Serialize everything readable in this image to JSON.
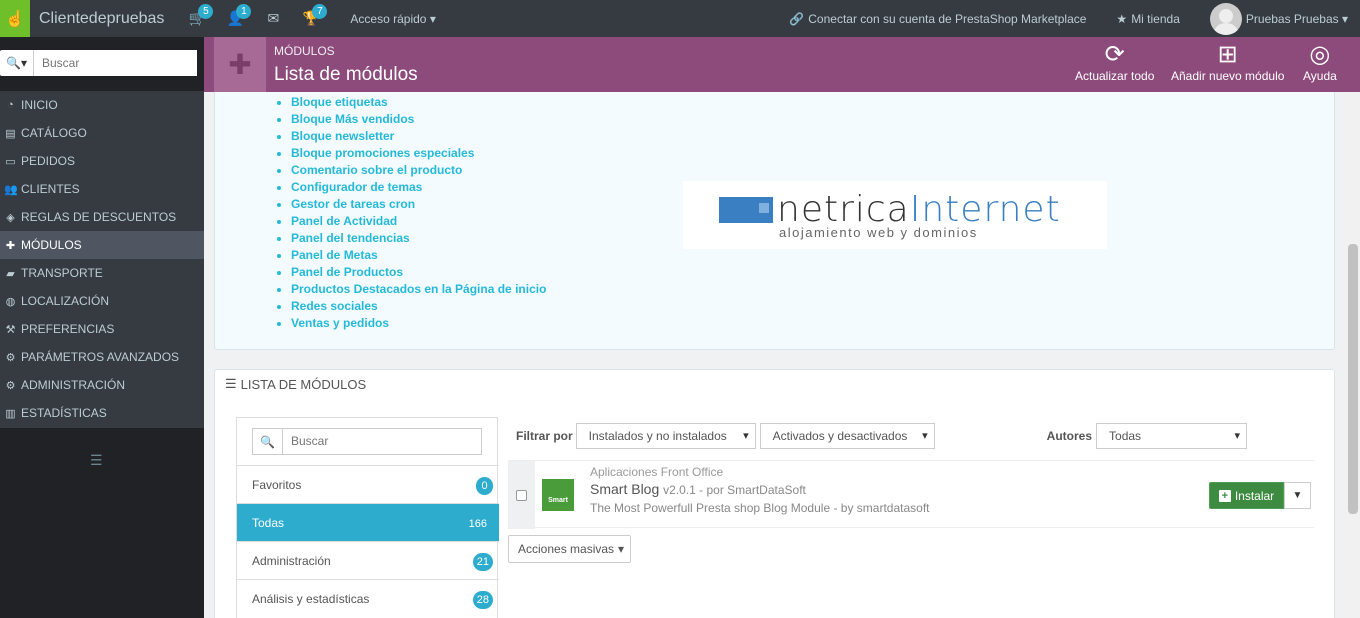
{
  "topbar": {
    "shop_name": "Clientedepruebas",
    "notifications": [
      {
        "icon": "cart-icon",
        "count": "5"
      },
      {
        "icon": "user-icon",
        "count": "1"
      },
      {
        "icon": "envelope-icon",
        "count": ""
      },
      {
        "icon": "trophy-icon",
        "count": "7"
      }
    ],
    "quick_access": "Acceso rápido",
    "marketplace": "Conectar con su cuenta de PrestaShop Marketplace",
    "my_shop": "Mi tienda",
    "user": "Pruebas Pruebas"
  },
  "sidebar": {
    "search_placeholder": "Buscar",
    "items": [
      {
        "label": "Inicio",
        "icon": "dashboard-icon"
      },
      {
        "label": "Catálogo",
        "icon": "book-icon"
      },
      {
        "label": "Pedidos",
        "icon": "credit-card-icon"
      },
      {
        "label": "Clientes",
        "icon": "users-icon"
      },
      {
        "label": "Reglas de descuentos",
        "icon": "tags-icon"
      },
      {
        "label": "Módulos",
        "icon": "puzzle-icon",
        "active": true
      },
      {
        "label": "Transporte",
        "icon": "truck-icon"
      },
      {
        "label": "Localización",
        "icon": "globe-icon"
      },
      {
        "label": "Preferencias",
        "icon": "wrench-icon"
      },
      {
        "label": "Parámetros avanzados",
        "icon": "cogs-icon"
      },
      {
        "label": "Administración",
        "icon": "cog-icon"
      },
      {
        "label": "Estadísticas",
        "icon": "bar-chart-icon"
      }
    ]
  },
  "header": {
    "breadcrumb": "MÓDULOS",
    "title": "Lista de módulos",
    "buttons": [
      {
        "label": "Actualizar todo",
        "icon": "refresh-icon"
      },
      {
        "label": "Añadir nuevo módulo",
        "icon": "plus-square-icon"
      },
      {
        "label": "Ayuda",
        "icon": "lifebuoy-icon"
      }
    ]
  },
  "installed_modules": [
    "Bloque etiquetas",
    "Bloque Más vendidos",
    "Bloque newsletter",
    "Bloque promociones especiales",
    "Comentario sobre el producto",
    "Configurador de temas",
    "Gestor de tareas cron",
    "Panel de Actividad",
    "Panel del tendencias",
    "Panel de Metas",
    "Panel de Productos",
    "Productos Destacados en la Página de inicio",
    "Redes sociales",
    "Ventas y pedidos"
  ],
  "banner": {
    "brand_a": "netrica",
    "brand_b": "Internet",
    "tagline": "alojamiento web y dominios"
  },
  "module_list": {
    "heading": "LISTA DE MÓDULOS",
    "search_placeholder": "Buscar",
    "categories": [
      {
        "label": "Favoritos",
        "count": "0"
      },
      {
        "label": "Todas",
        "count": "166",
        "active": true
      },
      {
        "label": "Administración",
        "count": "21"
      },
      {
        "label": "Análisis y estadísticas",
        "count": "28"
      }
    ],
    "filter_label": "Filtrar por",
    "filter_install": "Instalados y no instalados",
    "filter_active": "Activados y desactivados",
    "authors_label": "Autores",
    "authors_value": "Todas",
    "module": {
      "category": "Aplicaciones Front Office",
      "name": "Smart Blog",
      "version": "v2.0.1 - por SmartDataSoft",
      "description": "The Most Powerfull Presta shop Blog Module - by smartdatasoft",
      "logo_text": "Smart",
      "install_label": "Instalar"
    },
    "bulk_actions": "Acciones masivas"
  }
}
